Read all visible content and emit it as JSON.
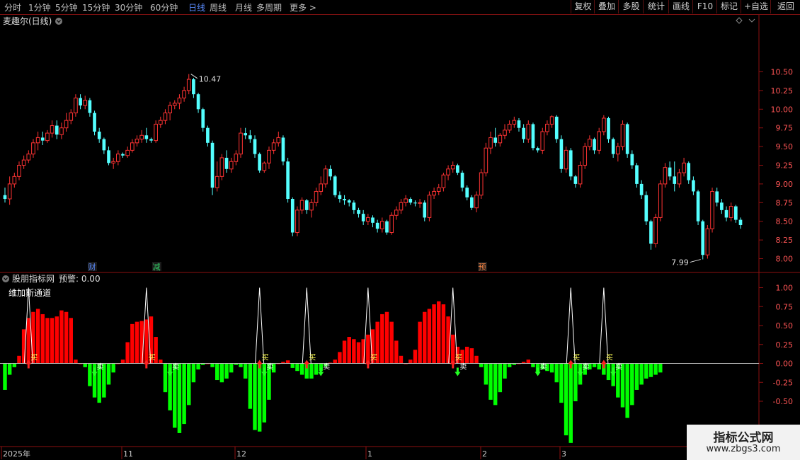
{
  "toolbar": {
    "periods": [
      "分时",
      "1分钟",
      "5分钟",
      "15分钟",
      "30分钟",
      "60分钟",
      "日线",
      "周线",
      "月线",
      "多周期",
      "更多 >"
    ],
    "active_period": "日线",
    "buttons": [
      "复权",
      "叠加",
      "多股",
      "统计",
      "画线",
      "F10",
      "标记",
      "+自选",
      "返回"
    ]
  },
  "main_panel": {
    "title": "麦趣尔(日线)",
    "max_label": "10.47",
    "min_label": "7.99",
    "event_markers": [
      "财",
      "减",
      "预"
    ]
  },
  "indicator_panel": {
    "title": "股朋指标网",
    "alert_label": "预警: 0.00",
    "subtitle": "维加斯通道",
    "buy_char": "买",
    "sell_char": "卖"
  },
  "time_axis": {
    "labels": [
      "2025年",
      "11",
      "12",
      "1",
      "2",
      "3"
    ]
  },
  "watermark": {
    "title": "指标公式网",
    "url": "www.zbgs3.com"
  },
  "colors": {
    "up": "#ff3333",
    "down": "#54ffff",
    "hist_up": "#ff0000",
    "hist_down": "#00ff00",
    "panel_border": "#8c1010"
  },
  "chart_data": [
    {
      "type": "candlestick",
      "title": "麦趣尔(日线)",
      "y_ticks": [
        8.0,
        8.25,
        8.5,
        8.75,
        9.0,
        9.25,
        9.5,
        9.75,
        10.0,
        10.25,
        10.5
      ],
      "ylim": [
        7.9,
        10.6
      ],
      "annotations": [
        {
          "text": "10.47",
          "value": 10.47
        },
        {
          "text": "7.99",
          "value": 7.99
        }
      ],
      "ohlc": [
        [
          8.85,
          8.95,
          8.75,
          8.8
        ],
        [
          8.8,
          9.1,
          8.72,
          9.0
        ],
        [
          9.0,
          9.15,
          8.95,
          9.1
        ],
        [
          9.1,
          9.3,
          9.05,
          9.25
        ],
        [
          9.25,
          9.38,
          9.2,
          9.32
        ],
        [
          9.32,
          9.45,
          9.28,
          9.4
        ],
        [
          9.4,
          9.6,
          9.35,
          9.55
        ],
        [
          9.55,
          9.7,
          9.45,
          9.62
        ],
        [
          9.62,
          9.7,
          9.52,
          9.58
        ],
        [
          9.58,
          9.72,
          9.55,
          9.68
        ],
        [
          9.68,
          9.85,
          9.62,
          9.78
        ],
        [
          9.78,
          9.85,
          9.6,
          9.66
        ],
        [
          9.66,
          9.82,
          9.6,
          9.75
        ],
        [
          9.75,
          9.95,
          9.7,
          9.85
        ],
        [
          9.85,
          10.0,
          9.8,
          9.95
        ],
        [
          9.95,
          10.2,
          9.9,
          10.15
        ],
        [
          10.15,
          10.2,
          10.0,
          10.05
        ],
        [
          10.05,
          10.18,
          10.0,
          10.12
        ],
        [
          10.12,
          10.15,
          9.9,
          9.95
        ],
        [
          9.95,
          9.98,
          9.65,
          9.7
        ],
        [
          9.7,
          9.75,
          9.55,
          9.6
        ],
        [
          9.6,
          9.62,
          9.4,
          9.45
        ],
        [
          9.45,
          9.5,
          9.25,
          9.28
        ],
        [
          9.28,
          9.35,
          9.2,
          9.3
        ],
        [
          9.3,
          9.45,
          9.25,
          9.4
        ],
        [
          9.4,
          9.42,
          9.35,
          9.38
        ],
        [
          9.38,
          9.5,
          9.35,
          9.45
        ],
        [
          9.45,
          9.6,
          9.42,
          9.55
        ],
        [
          9.55,
          9.65,
          9.5,
          9.6
        ],
        [
          9.6,
          9.72,
          9.55,
          9.65
        ],
        [
          9.65,
          9.75,
          9.55,
          9.6
        ],
        [
          9.6,
          9.62,
          9.55,
          9.58
        ],
        [
          9.58,
          9.85,
          9.55,
          9.8
        ],
        [
          9.8,
          9.9,
          9.75,
          9.85
        ],
        [
          9.85,
          10.0,
          9.8,
          9.95
        ],
        [
          9.95,
          10.1,
          9.85,
          10.05
        ],
        [
          10.05,
          10.12,
          10.0,
          10.08
        ],
        [
          10.08,
          10.2,
          10.0,
          10.15
        ],
        [
          10.15,
          10.3,
          10.1,
          10.25
        ],
        [
          10.25,
          10.47,
          10.2,
          10.4
        ],
        [
          10.4,
          10.42,
          10.15,
          10.2
        ],
        [
          10.2,
          10.22,
          9.95,
          10.0
        ],
        [
          10.0,
          10.02,
          9.7,
          9.75
        ],
        [
          9.75,
          9.78,
          9.5,
          9.55
        ],
        [
          9.55,
          9.58,
          8.85,
          8.95
        ],
        [
          8.95,
          9.3,
          8.9,
          9.1
        ],
        [
          9.1,
          9.4,
          9.05,
          9.35
        ],
        [
          9.35,
          9.45,
          9.15,
          9.2
        ],
        [
          9.2,
          9.35,
          9.15,
          9.3
        ],
        [
          9.3,
          9.45,
          9.25,
          9.4
        ],
        [
          9.4,
          9.75,
          9.35,
          9.68
        ],
        [
          9.68,
          9.75,
          9.6,
          9.65
        ],
        [
          9.65,
          9.72,
          9.55,
          9.6
        ],
        [
          9.6,
          9.65,
          9.35,
          9.4
        ],
        [
          9.4,
          9.42,
          9.15,
          9.18
        ],
        [
          9.18,
          9.3,
          9.15,
          9.28
        ],
        [
          9.28,
          9.5,
          9.2,
          9.45
        ],
        [
          9.45,
          9.6,
          9.4,
          9.55
        ],
        [
          9.55,
          9.7,
          9.5,
          9.62
        ],
        [
          9.62,
          9.65,
          9.25,
          9.3
        ],
        [
          9.3,
          9.35,
          8.75,
          8.8
        ],
        [
          8.8,
          8.82,
          8.3,
          8.35
        ],
        [
          8.35,
          8.7,
          8.3,
          8.65
        ],
        [
          8.65,
          8.82,
          8.6,
          8.78
        ],
        [
          8.78,
          8.8,
          8.6,
          8.65
        ],
        [
          8.65,
          8.8,
          8.55,
          8.75
        ],
        [
          8.75,
          8.95,
          8.7,
          8.9
        ],
        [
          8.9,
          9.1,
          8.85,
          9.0
        ],
        [
          9.0,
          9.25,
          8.95,
          9.2
        ],
        [
          9.2,
          9.25,
          9.05,
          9.1
        ],
        [
          9.1,
          9.12,
          8.82,
          8.85
        ],
        [
          8.85,
          8.9,
          8.75,
          8.8
        ],
        [
          8.8,
          8.85,
          8.72,
          8.78
        ],
        [
          8.78,
          8.8,
          8.7,
          8.75
        ],
        [
          8.75,
          8.78,
          8.6,
          8.65
        ],
        [
          8.65,
          8.68,
          8.55,
          8.6
        ],
        [
          8.6,
          8.65,
          8.45,
          8.5
        ],
        [
          8.5,
          8.6,
          8.45,
          8.55
        ],
        [
          8.55,
          8.58,
          8.42,
          8.48
        ],
        [
          8.48,
          8.52,
          8.35,
          8.4
        ],
        [
          8.4,
          8.55,
          8.35,
          8.5
        ],
        [
          8.5,
          8.52,
          8.32,
          8.35
        ],
        [
          8.35,
          8.62,
          8.32,
          8.58
        ],
        [
          8.58,
          8.7,
          8.52,
          8.65
        ],
        [
          8.65,
          8.8,
          8.6,
          8.75
        ],
        [
          8.75,
          8.85,
          8.7,
          8.8
        ],
        [
          8.8,
          8.82,
          8.72,
          8.75
        ],
        [
          8.75,
          8.78,
          8.7,
          8.74
        ],
        [
          8.74,
          8.8,
          8.68,
          8.75
        ],
        [
          8.75,
          8.78,
          8.5,
          8.55
        ],
        [
          8.55,
          8.9,
          8.5,
          8.85
        ],
        [
          8.85,
          8.95,
          8.8,
          8.9
        ],
        [
          8.9,
          9.0,
          8.85,
          8.95
        ],
        [
          8.95,
          9.15,
          8.9,
          9.12
        ],
        [
          9.12,
          9.25,
          9.05,
          9.2
        ],
        [
          9.2,
          9.3,
          9.15,
          9.25
        ],
        [
          9.25,
          9.27,
          9.12,
          9.15
        ],
        [
          9.15,
          9.18,
          8.9,
          8.95
        ],
        [
          8.95,
          8.98,
          8.78,
          8.82
        ],
        [
          8.82,
          8.85,
          8.65,
          8.68
        ],
        [
          8.68,
          8.9,
          8.62,
          8.85
        ],
        [
          8.85,
          9.2,
          8.8,
          9.15
        ],
        [
          9.15,
          9.55,
          9.1,
          9.48
        ],
        [
          9.48,
          9.7,
          9.4,
          9.62
        ],
        [
          9.62,
          9.75,
          9.5,
          9.55
        ],
        [
          9.55,
          9.68,
          9.5,
          9.65
        ],
        [
          9.65,
          9.8,
          9.6,
          9.72
        ],
        [
          9.72,
          9.85,
          9.68,
          9.8
        ],
        [
          9.8,
          9.9,
          9.75,
          9.85
        ],
        [
          9.85,
          9.88,
          9.7,
          9.75
        ],
        [
          9.75,
          9.8,
          9.55,
          9.6
        ],
        [
          9.6,
          9.85,
          9.55,
          9.8
        ],
        [
          9.8,
          9.82,
          9.45,
          9.48
        ],
        [
          9.48,
          9.5,
          9.42,
          9.45
        ],
        [
          9.45,
          9.75,
          9.4,
          9.7
        ],
        [
          9.7,
          9.85,
          9.65,
          9.8
        ],
        [
          9.8,
          9.92,
          9.75,
          9.9
        ],
        [
          9.9,
          9.92,
          9.55,
          9.6
        ],
        [
          9.6,
          9.65,
          9.15,
          9.2
        ],
        [
          9.2,
          9.5,
          9.15,
          9.45
        ],
        [
          9.45,
          9.48,
          9.05,
          9.1
        ],
        [
          9.1,
          9.12,
          8.95,
          9.0
        ],
        [
          9.0,
          9.3,
          8.95,
          9.25
        ],
        [
          9.25,
          9.55,
          9.2,
          9.5
        ],
        [
          9.5,
          9.65,
          9.45,
          9.6
        ],
        [
          9.6,
          9.62,
          9.4,
          9.45
        ],
        [
          9.45,
          9.75,
          9.4,
          9.7
        ],
        [
          9.7,
          9.92,
          9.65,
          9.88
        ],
        [
          9.88,
          9.9,
          9.55,
          9.6
        ],
        [
          9.6,
          9.62,
          9.35,
          9.4
        ],
        [
          9.4,
          9.55,
          9.3,
          9.5
        ],
        [
          9.5,
          9.85,
          9.45,
          9.8
        ],
        [
          9.8,
          9.82,
          9.35,
          9.4
        ],
        [
          9.4,
          9.45,
          9.2,
          9.25
        ],
        [
          9.25,
          9.28,
          8.95,
          9.0
        ],
        [
          9.0,
          9.05,
          8.8,
          8.85
        ],
        [
          8.85,
          8.9,
          8.45,
          8.5
        ],
        [
          8.5,
          8.52,
          8.12,
          8.2
        ],
        [
          8.2,
          8.6,
          8.15,
          8.55
        ],
        [
          8.55,
          9.05,
          8.5,
          9.0
        ],
        [
          9.0,
          9.28,
          8.95,
          9.22
        ],
        [
          9.22,
          9.3,
          9.05,
          9.1
        ],
        [
          9.1,
          9.3,
          8.9,
          9.0
        ],
        [
          9.0,
          9.2,
          8.95,
          9.15
        ],
        [
          9.15,
          9.35,
          9.1,
          9.28
        ],
        [
          9.28,
          9.3,
          9.0,
          9.05
        ],
        [
          9.05,
          9.1,
          8.85,
          8.9
        ],
        [
          8.9,
          8.92,
          8.45,
          8.5
        ],
        [
          8.5,
          8.52,
          7.99,
          8.05
        ],
        [
          8.05,
          8.45,
          8.0,
          8.4
        ],
        [
          8.4,
          8.95,
          8.35,
          8.9
        ],
        [
          8.9,
          8.95,
          8.7,
          8.75
        ],
        [
          8.75,
          8.8,
          8.6,
          8.65
        ],
        [
          8.65,
          8.7,
          8.5,
          8.55
        ],
        [
          8.55,
          8.75,
          8.5,
          8.7
        ],
        [
          8.7,
          8.72,
          8.48,
          8.52
        ],
        [
          8.52,
          8.55,
          8.4,
          8.45
        ]
      ]
    },
    {
      "type": "bar",
      "title": "股朋指标网",
      "series_name": "维加斯通道",
      "y_ticks": [
        -0.5,
        -0.25,
        0.0,
        0.25,
        0.5,
        0.75,
        1.0
      ],
      "ylim": [
        -0.62,
        1.12
      ],
      "values": [
        -0.35,
        -0.15,
        -0.05,
        0.1,
        0.45,
        0.6,
        0.68,
        0.72,
        0.65,
        0.6,
        0.6,
        0.62,
        0.7,
        0.68,
        0.6,
        0.05,
        0.0,
        -0.05,
        -0.3,
        -0.45,
        -0.52,
        -0.45,
        -0.28,
        -0.12,
        0.0,
        0.05,
        0.28,
        0.52,
        0.55,
        0.56,
        0.58,
        0.62,
        0.35,
        0.05,
        -0.38,
        -0.62,
        -0.85,
        -0.92,
        -0.8,
        -0.55,
        -0.25,
        -0.08,
        -0.02,
        0.0,
        -0.05,
        -0.22,
        -0.25,
        -0.2,
        -0.12,
        -0.02,
        -0.05,
        -0.2,
        -0.6,
        -0.88,
        -0.9,
        -0.78,
        -0.48,
        -0.12,
        0.0,
        0.02,
        0.04,
        -0.06,
        -0.1,
        -0.15,
        -0.2,
        -0.2,
        -0.15,
        -0.1,
        -0.04,
        0.01,
        0.05,
        0.15,
        0.3,
        0.35,
        0.32,
        0.28,
        0.32,
        0.38,
        0.45,
        0.55,
        0.65,
        0.68,
        0.55,
        0.3,
        0.1,
        0.0,
        0.05,
        0.18,
        0.55,
        0.68,
        0.72,
        0.78,
        0.82,
        0.78,
        0.62,
        0.38,
        0.22,
        0.18,
        0.22,
        0.2,
        0.1,
        -0.05,
        -0.28,
        -0.48,
        -0.55,
        -0.38,
        -0.2,
        -0.05,
        -0.02,
        0.0,
        0.02,
        0.05,
        -0.05,
        -0.12,
        -0.08,
        -0.1,
        -0.12,
        -0.25,
        -0.52,
        -0.95,
        -1.05,
        -0.5,
        -0.28,
        -0.15,
        -0.08,
        -0.05,
        -0.08,
        -0.15,
        -0.22,
        -0.3,
        -0.45,
        -0.58,
        -0.72,
        -0.55,
        -0.35,
        -0.28,
        -0.2,
        -0.18,
        -0.15,
        -0.12
      ],
      "trigger_spikes": [
        5,
        30,
        54,
        64,
        77,
        95,
        120,
        127
      ],
      "buy_signals": [
        5,
        30,
        54,
        64,
        77,
        95,
        120,
        127
      ],
      "sell_signals": [
        19,
        35,
        55,
        67,
        96,
        113,
        122,
        129
      ]
    }
  ]
}
